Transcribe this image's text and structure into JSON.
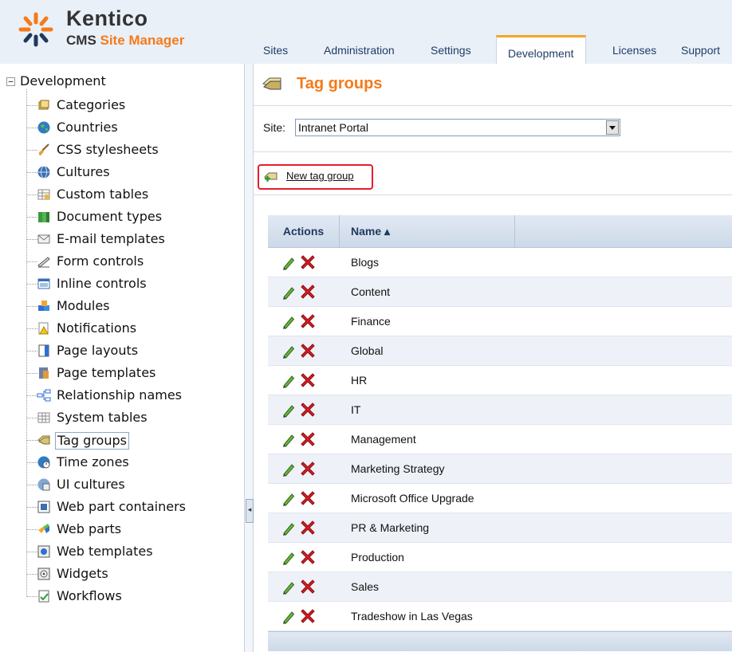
{
  "header": {
    "logo_name": "Kentico",
    "logo_sub_plain": "CMS ",
    "logo_sub_accent": "Site Manager",
    "tabs": [
      {
        "label": "Sites"
      },
      {
        "label": "Administration"
      },
      {
        "label": "Settings"
      },
      {
        "label": "Development",
        "active": true
      },
      {
        "label": "Licenses"
      },
      {
        "label": "Support"
      }
    ]
  },
  "tree": {
    "root": "Development",
    "root_toggle": "−",
    "items": [
      {
        "label": "Categories",
        "icon": "categories-icon"
      },
      {
        "label": "Countries",
        "icon": "globe-icon"
      },
      {
        "label": "CSS stylesheets",
        "icon": "brush-icon"
      },
      {
        "label": "Cultures",
        "icon": "culture-globe-icon"
      },
      {
        "label": "Custom tables",
        "icon": "custom-table-icon"
      },
      {
        "label": "Document types",
        "icon": "document-types-icon"
      },
      {
        "label": "E-mail templates",
        "icon": "email-template-icon"
      },
      {
        "label": "Form controls",
        "icon": "form-control-icon"
      },
      {
        "label": "Inline controls",
        "icon": "inline-control-icon"
      },
      {
        "label": "Modules",
        "icon": "modules-icon"
      },
      {
        "label": "Notifications",
        "icon": "notification-icon"
      },
      {
        "label": "Page layouts",
        "icon": "page-layout-icon"
      },
      {
        "label": "Page templates",
        "icon": "page-template-icon"
      },
      {
        "label": "Relationship names",
        "icon": "relationship-icon"
      },
      {
        "label": "System tables",
        "icon": "system-table-icon"
      },
      {
        "label": "Tag groups",
        "icon": "tag-group-icon",
        "selected": true
      },
      {
        "label": "Time zones",
        "icon": "time-zone-icon"
      },
      {
        "label": "UI cultures",
        "icon": "ui-culture-icon"
      },
      {
        "label": "Web part containers",
        "icon": "webpart-container-icon"
      },
      {
        "label": "Web parts",
        "icon": "webparts-icon"
      },
      {
        "label": "Web templates",
        "icon": "web-template-icon"
      },
      {
        "label": "Widgets",
        "icon": "widget-icon"
      },
      {
        "label": "Workflows",
        "icon": "workflow-icon"
      }
    ]
  },
  "main": {
    "title": "Tag groups",
    "site_label": "Site:",
    "site_value": "Intranet Portal",
    "new_button_label": "New tag group",
    "grid": {
      "col_actions": "Actions",
      "col_name": "Name ▴",
      "rows": [
        "Blogs",
        "Content",
        "Finance",
        "Global",
        "HR",
        "IT",
        "Management",
        "Marketing Strategy",
        "Microsoft Office Upgrade",
        "PR & Marketing",
        "Production",
        "Sales",
        "Tradeshow in Las Vegas"
      ]
    }
  },
  "colors": {
    "accent_orange": "#f57a1a",
    "header_bg": "#eaf0f8",
    "highlight_red": "#e81c2b",
    "active_tab_top": "#f5a623"
  }
}
